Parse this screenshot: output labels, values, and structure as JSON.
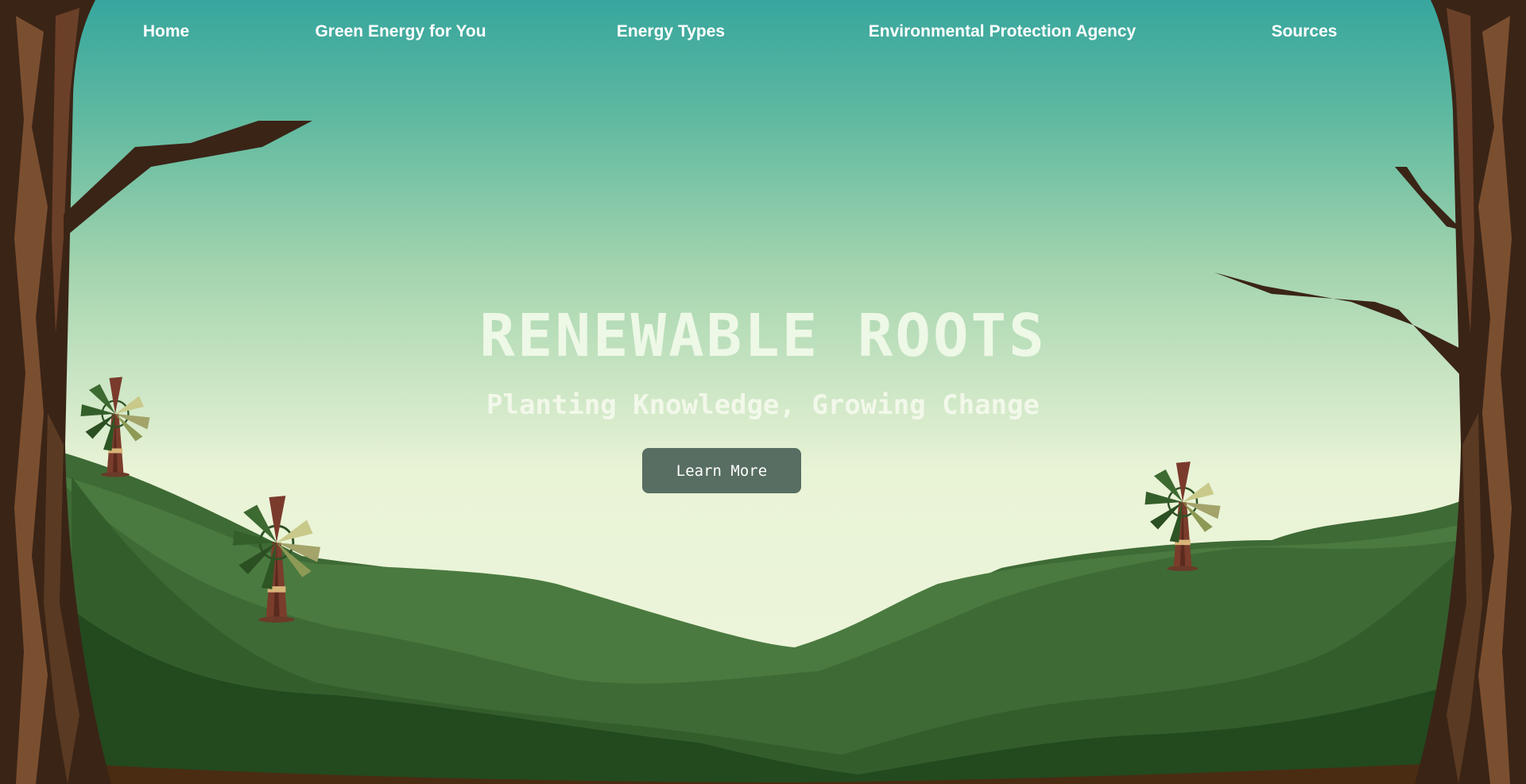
{
  "nav": {
    "items": [
      {
        "label": "Home"
      },
      {
        "label": "Green Energy for You"
      },
      {
        "label": "Energy Types"
      },
      {
        "label": "Environmental Protection Agency"
      },
      {
        "label": "Sources"
      }
    ]
  },
  "hero": {
    "title": "RENEWABLE ROOTS",
    "subtitle": "Planting Knowledge, Growing Change",
    "button_label": "Learn More"
  },
  "colors": {
    "sky_top": "#3aa89f",
    "sky_bottom": "#eef6dc",
    "hill_light": "#4a7a3f",
    "hill_dark": "#23491f",
    "bark": "#3a2416",
    "button": "#586e62"
  },
  "icons": {
    "windmill": "windmill-icon"
  }
}
